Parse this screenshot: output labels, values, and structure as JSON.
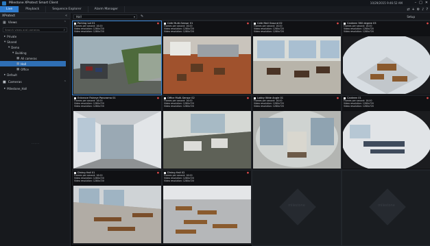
{
  "app": {
    "title": "Milestone XProtect Smart Client",
    "clock": "10/29/2015 9:46:52 AM",
    "window_controls": [
      "–",
      "□",
      "✕"
    ]
  },
  "tabs": [
    {
      "label": "Live",
      "active": true
    },
    {
      "label": "Playback",
      "active": false
    },
    {
      "label": "Sequence Explorer",
      "active": false
    },
    {
      "label": "Alarm Manager",
      "active": false
    }
  ],
  "toolbar_icons": [
    "sync-icon",
    "plus-icon",
    "gear-icon",
    "bell-icon",
    "help-icon"
  ],
  "sidebar": {
    "header": "XProtect",
    "views_label": "Views",
    "search_placeholder": "Search views and cameras",
    "tree": [
      {
        "label": "Private",
        "depth": 0,
        "icon": "▸"
      },
      {
        "label": "Shared",
        "depth": 0,
        "icon": "▾"
      },
      {
        "label": "Demo",
        "depth": 1,
        "icon": "▾"
      },
      {
        "label": "Building",
        "depth": 2,
        "icon": "▾"
      },
      {
        "label": "All cameras",
        "depth": 3,
        "icon": "▦"
      },
      {
        "label": "Hall",
        "depth": 3,
        "icon": "▦",
        "selected": true
      },
      {
        "label": "Office",
        "depth": 3,
        "icon": "▦"
      },
      {
        "label": "Default",
        "depth": 0,
        "icon": "▸"
      }
    ],
    "cameras_label": "Cameras",
    "camera_tree": [
      {
        "label": "Milestone_Hall",
        "icon": "▸"
      }
    ],
    "placeholder": "- - - - -"
  },
  "viewbar": {
    "selected_view": "Hall",
    "setup_label": "Setup"
  },
  "tiles": [
    {
      "camera": "Parking Lot 01",
      "fps": "Frames per second: 16.00",
      "res": "Video resolution: 1280x720",
      "status": "Video resolution: 1280x720",
      "scene": "parking",
      "selected": true
    },
    {
      "camera": "Cafe Multi-Sensor 01",
      "fps": "Frames per second: 16.00",
      "res": "Video resolution: 1280x720",
      "status": "Video resolution: 1280x720",
      "scene": "cafe",
      "selected": false
    },
    {
      "camera": "Cafe Mall Ground 02",
      "fps": "Frames per second: 16.00",
      "res": "Video resolution: 1280x720",
      "status": "Video resolution: 1280x720",
      "scene": "hall",
      "selected": false
    },
    {
      "camera": "Canteen 360 degree 03",
      "fps": "Frames per second: 16.00",
      "res": "Video resolution: 1280x720",
      "status": "Video resolution: 1280x720",
      "scene": "fisheye",
      "selected": false
    },
    {
      "camera": "Entrance Fisheye Panorama 01",
      "fps": "Frames per second: 16.00",
      "res": "Video resolution: 1280x720",
      "status": "Video resolution: 1280x720",
      "scene": "corridor",
      "selected": false
    },
    {
      "camera": "Office Multi-Sensor 02",
      "fps": "Frames per second: 16.00",
      "res": "Video resolution: 1280x720",
      "status": "Video resolution: 1280x720",
      "scene": "office",
      "selected": false
    },
    {
      "camera": "Lobby Wide Angle 01",
      "fps": "Frames per second: 16.00",
      "res": "Video resolution: 1280x720",
      "status": "Video resolution: 1280x720",
      "scene": "lobby",
      "selected": false
    },
    {
      "camera": "Canteen 01",
      "fps": "Frames per second: 16.00",
      "res": "Video resolution: 1280x720",
      "status": "Video resolution: 1280x720",
      "scene": "fisheye2",
      "selected": false
    },
    {
      "camera": "Dining Hall 01",
      "fps": "Frames per second: 16.00",
      "res": "Video resolution: 1280x720",
      "status": "Video resolution: 1280x720",
      "scene": "dining",
      "selected": false
    },
    {
      "camera": "Dining Hall 02",
      "fps": "Frames per second: 16.00",
      "res": "Video resolution: 1280x720",
      "status": "Video resolution: 1280x720",
      "scene": "canteen",
      "selected": false
    }
  ],
  "empty_tiles": [
    {
      "brand": "milestone"
    },
    {
      "brand": "milestone"
    }
  ],
  "colors": {
    "accent": "#2f7dd0",
    "recording": "#e24a4a",
    "background": "#0c0d0f"
  }
}
